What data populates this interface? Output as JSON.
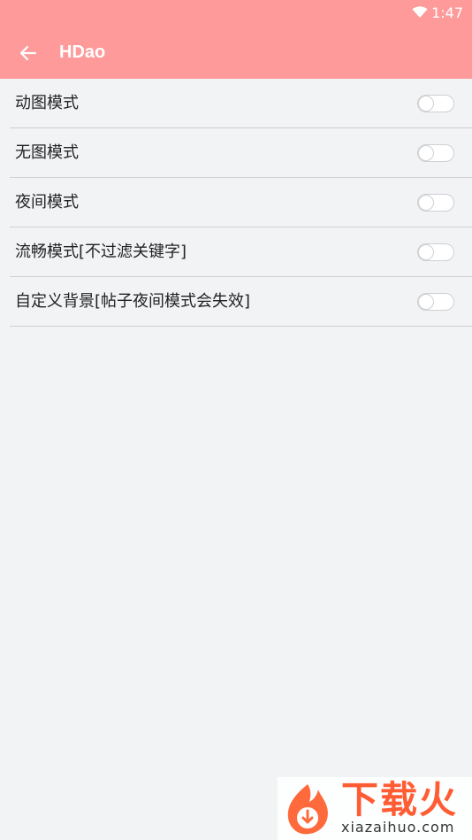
{
  "status_bar": {
    "time": "1:47",
    "wifi_icon": "wifi-icon"
  },
  "app_bar": {
    "back_icon": "arrow-left-icon",
    "title": "HDao",
    "color": "#ff9a9a"
  },
  "settings": [
    {
      "label": "动图模式",
      "enabled": false
    },
    {
      "label": "无图模式",
      "enabled": false
    },
    {
      "label": "夜间模式",
      "enabled": false
    },
    {
      "label": "流畅模式[不过滤关键字]",
      "enabled": false
    },
    {
      "label": "自定义背景[帖子夜间模式会失效]",
      "enabled": false
    }
  ],
  "watermark": {
    "text": "下载火",
    "url": "xiazaihuo.com",
    "logo_icon": "flame-download-logo"
  },
  "colors": {
    "accent": "#ff9a9a",
    "background": "#f2f3f5",
    "divider": "#cfcfd2",
    "watermark": "#ff5c33"
  }
}
